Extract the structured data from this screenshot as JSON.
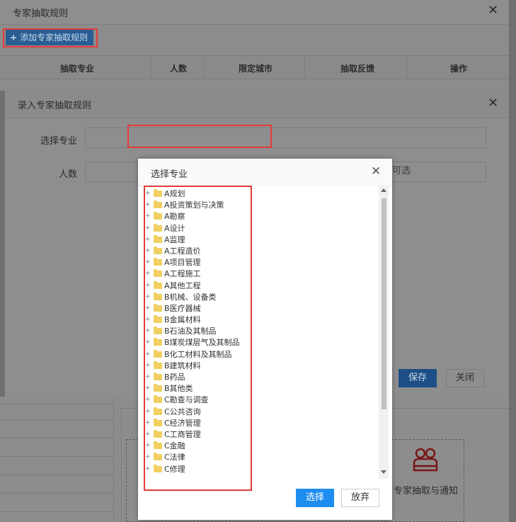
{
  "bg_dialog": {
    "title": "专家抽取规则",
    "close": "✕",
    "add_button": "添加专家抽取规则",
    "columns": [
      "抽取专业",
      "人数",
      "限定城市",
      "抽取反馈",
      "操作"
    ]
  },
  "entry_dialog": {
    "title": "录入专家抽取规则",
    "close": "✕",
    "specialty_label": "选择专业",
    "count_label": "人数",
    "count_field_partial": "可选",
    "save": "保存",
    "close_button": "关闭"
  },
  "bg_lower": {
    "notify_label": "专家抽取与通知"
  },
  "select_dialog": {
    "title": "选择专业",
    "close": "✕",
    "choose": "选择",
    "abandon": "放弃",
    "items": [
      "A规划",
      "A投资策划与决策",
      "A勘察",
      "A设计",
      "A监理",
      "A工程造价",
      "A项目管理",
      "A工程施工",
      "A其他工程",
      "B机械、设备类",
      "B医疗器械",
      "B金属材料",
      "B石油及其制品",
      "B煤炭煤层气及其制品",
      "B化工材料及其制品",
      "B建筑材料",
      "B药品",
      "B其他类",
      "C勘查与调查",
      "C公共咨询",
      "C经济管理",
      "C工商管理",
      "C金融",
      "C法律",
      "C修理"
    ]
  },
  "colors": {
    "accent": "#1e8df0",
    "highlight": "#e53a3a",
    "folder": "#f2cf61"
  }
}
